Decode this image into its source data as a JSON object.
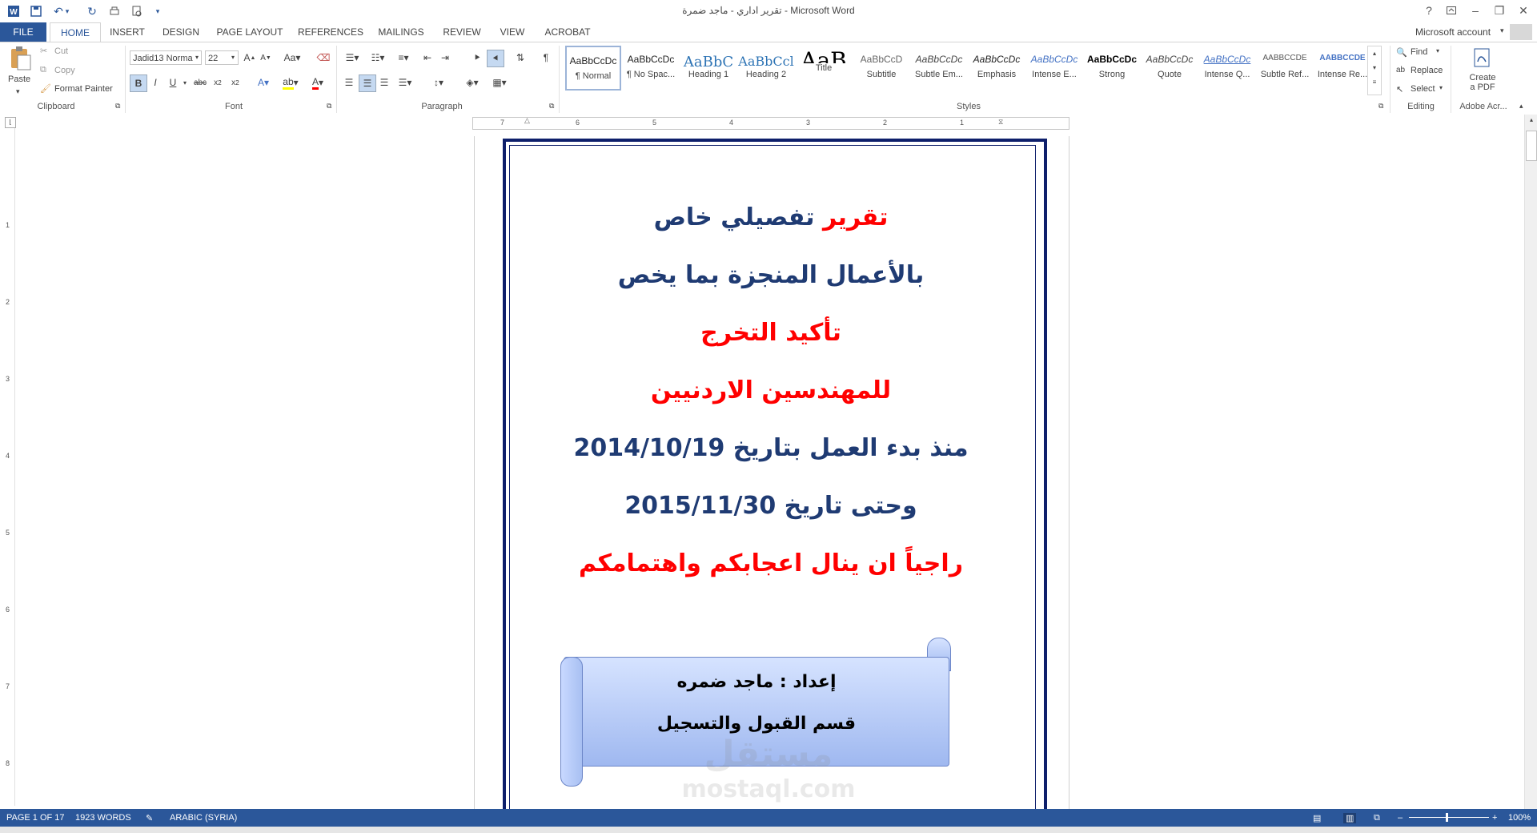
{
  "window": {
    "title": "تقرير اداري - ماجد ضمرة - Microsoft Word",
    "account": "Microsoft account",
    "help": "?"
  },
  "tabs": [
    "FILE",
    "HOME",
    "INSERT",
    "DESIGN",
    "PAGE LAYOUT",
    "REFERENCES",
    "MAILINGS",
    "REVIEW",
    "VIEW",
    "ACROBAT"
  ],
  "clipboard": {
    "paste": "Paste",
    "cut": "Cut",
    "copy": "Copy",
    "format_painter": "Format Painter",
    "label": "Clipboard"
  },
  "font": {
    "name": "Jadid13 Norma",
    "size": "22",
    "label": "Font"
  },
  "paragraph": {
    "label": "Paragraph"
  },
  "styles": {
    "label": "Styles",
    "items": [
      {
        "preview": "AaBbCcDc",
        "name": "¶ Normal"
      },
      {
        "preview": "AaBbCcDc",
        "name": "¶ No Spac..."
      },
      {
        "preview": "AaBbC",
        "name": "Heading 1"
      },
      {
        "preview": "AaBbCcl",
        "name": "Heading 2"
      },
      {
        "preview": "AaB",
        "name": "Title"
      },
      {
        "preview": "AaBbCcD",
        "name": "Subtitle"
      },
      {
        "preview": "AaBbCcDc",
        "name": "Subtle Em..."
      },
      {
        "preview": "AaBbCcDc",
        "name": "Emphasis"
      },
      {
        "preview": "AaBbCcDc",
        "name": "Intense E..."
      },
      {
        "preview": "AaBbCcDc",
        "name": "Strong"
      },
      {
        "preview": "AaBbCcDc",
        "name": "Quote"
      },
      {
        "preview": "AaBbCcDc",
        "name": "Intense Q..."
      },
      {
        "preview": "AABBCCDE",
        "name": "Subtle Ref..."
      },
      {
        "preview": "AABBCCDE",
        "name": "Intense Re..."
      }
    ]
  },
  "editing": {
    "find": "Find",
    "replace": "Replace",
    "select": "Select",
    "label": "Editing"
  },
  "acrobat": {
    "create_line1": "Create",
    "create_line2": "a PDF",
    "label": "Adobe Acr..."
  },
  "ruler": {
    "h": [
      "7",
      "6",
      "5",
      "4",
      "3",
      "2",
      "1"
    ],
    "v": [
      "1",
      "2",
      "3",
      "4",
      "5",
      "6",
      "7",
      "8"
    ]
  },
  "document": {
    "lines": [
      {
        "parts": [
          {
            "t": "تقرير",
            "c": "red"
          },
          {
            "t": " تفصيلي خاص",
            "c": "blue"
          }
        ]
      },
      {
        "parts": [
          {
            "t": "بالأعمال المنجزة بما يخص",
            "c": "blue"
          }
        ]
      },
      {
        "parts": [
          {
            "t": "تأكيد التخرج",
            "c": "red"
          }
        ]
      },
      {
        "parts": [
          {
            "t": "للمهندسين الاردنيين",
            "c": "red"
          }
        ]
      },
      {
        "parts": [
          {
            "t": "منذ بدء العمل بتاريخ 2014/10/19",
            "c": "blue"
          }
        ]
      },
      {
        "parts": [
          {
            "t": "وحتى تاريخ 2015/11/30",
            "c": "blue"
          }
        ]
      },
      {
        "parts": [
          {
            "t": "راجياً ان ينال اعجابكم واهتمامكم",
            "c": "red"
          }
        ]
      }
    ],
    "scroll_line1": "إعداد : ماجد ضمره",
    "scroll_line2": "قسم القبول والتسجيل"
  },
  "watermark": {
    "arabic": "مستقل",
    "latin": "mostaql.com"
  },
  "status": {
    "page": "PAGE 1 OF 17",
    "words": "1923 WORDS",
    "language": "ARABIC (SYRIA)",
    "zoom": "100%"
  }
}
